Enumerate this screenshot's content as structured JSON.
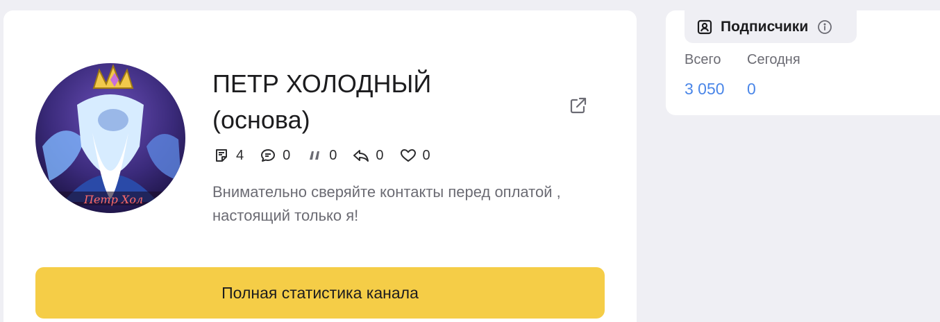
{
  "channel": {
    "title": "ПЕТР ХОЛОДНЫЙ (основа)",
    "description": "Внимательно сверяйте контакты перед оплатой , настоящий только я!",
    "avatar_caption": "Петр Хол",
    "stats": [
      {
        "icon": "posts-icon",
        "value": "4"
      },
      {
        "icon": "comments-icon",
        "value": "0"
      },
      {
        "icon": "quotes-icon",
        "value": "0"
      },
      {
        "icon": "reposts-icon",
        "value": "0"
      },
      {
        "icon": "likes-icon",
        "value": "0"
      }
    ],
    "external_link_icon": "external-link-icon",
    "full_stats_label": "Полная статистика канала",
    "button_color": "#f5cd47"
  },
  "subscribers": {
    "tab_label": "Подписчики",
    "tab_icon": "subscribers-icon",
    "info_icon": "info-icon",
    "total_label": "Всего",
    "total_value": "3 050",
    "today_label": "Сегодня",
    "today_value": "0",
    "value_color": "#4a86e8"
  }
}
